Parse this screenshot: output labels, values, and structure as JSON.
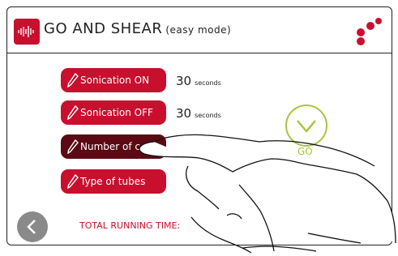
{
  "header": {
    "title": "GO AND SHEAR",
    "mode": "(easy mode)",
    "app_icon": "waveform-icon",
    "logo_icon": "dots-logo-icon"
  },
  "parameters": [
    {
      "label": "Sonication ON",
      "value": "30",
      "unit": "seconds",
      "icon": "pencil-icon"
    },
    {
      "label": "Sonication OFF",
      "value": "30",
      "unit": "seconds",
      "icon": "pencil-icon"
    },
    {
      "label": "Number of c",
      "value": "",
      "unit": "",
      "icon": "pencil-icon"
    },
    {
      "label": "Type of tubes",
      "value": "",
      "unit": "",
      "icon": "pencil-icon"
    }
  ],
  "go": {
    "label": "GO",
    "icon": "chevron-down-icon"
  },
  "back": {
    "icon": "chevron-left-icon"
  },
  "total": {
    "label": "TOTAL RUNNING TIME:"
  },
  "colors": {
    "accent": "#c8102e",
    "accent_dark": "#5b0a14",
    "go_green": "#a8c53a",
    "back_grey": "#8a8a8a"
  }
}
